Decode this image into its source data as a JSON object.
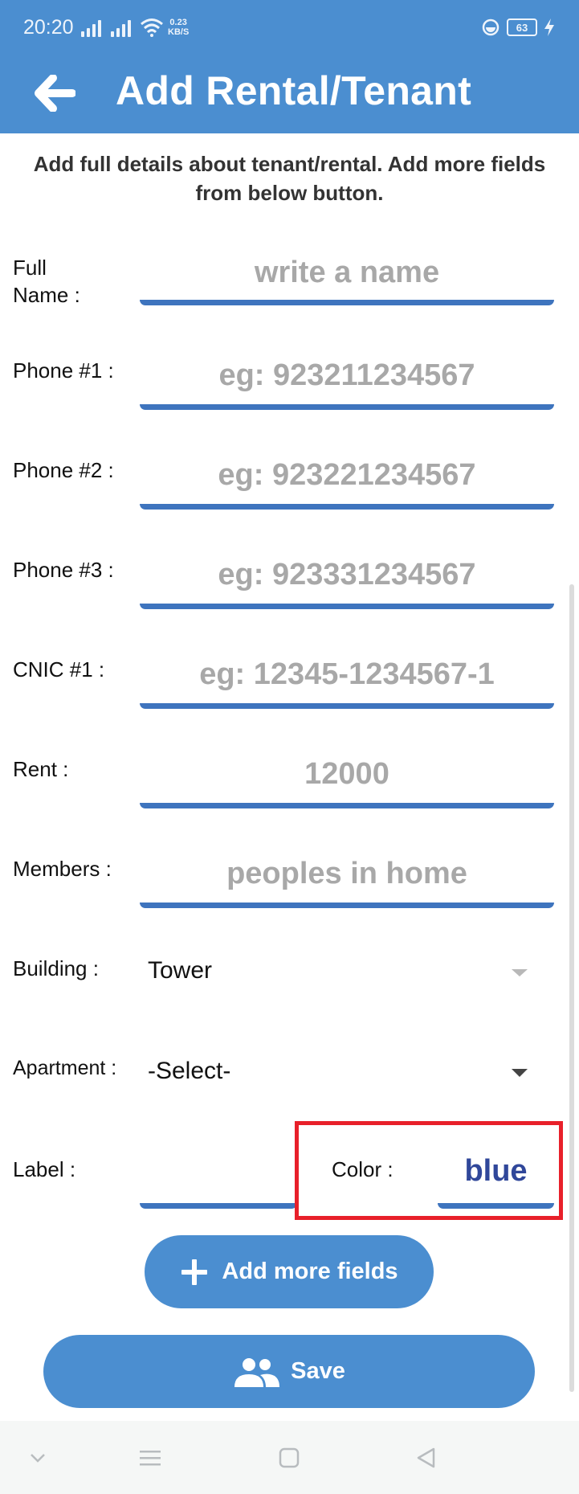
{
  "status_bar": {
    "time": "20:20",
    "speed": "0.23",
    "speed_unit": "KB/S",
    "battery": "63"
  },
  "header": {
    "title": "Add Rental/Tenant"
  },
  "intro": {
    "line1": "Add full details about tenant/rental. Add more fields",
    "line2": "from below button."
  },
  "form": {
    "full_name": {
      "label_line1": "Full",
      "label_line2": "Name :",
      "placeholder": "write a name"
    },
    "phone1": {
      "label": "Phone #1 :",
      "placeholder": "eg: 923211234567"
    },
    "phone2": {
      "label": "Phone #2 :",
      "placeholder": "eg: 923221234567"
    },
    "phone3": {
      "label": "Phone #3 :",
      "placeholder": "eg: 923331234567"
    },
    "cnic1": {
      "label": "CNIC #1 :",
      "placeholder": "eg: 12345-1234567-1"
    },
    "rent": {
      "label": "Rent :",
      "placeholder": "12000"
    },
    "members": {
      "label": "Members :",
      "placeholder": "peoples in home"
    },
    "building": {
      "label": "Building :",
      "value": "Tower"
    },
    "apartment": {
      "label": "Apartment :",
      "value": "-Select-"
    },
    "label_field": {
      "label": "Label :",
      "value": ""
    },
    "color_field": {
      "label": "Color :",
      "value": "blue"
    }
  },
  "buttons": {
    "add_more": "Add more fields",
    "save": "Save"
  },
  "colors": {
    "primary": "#4b8ed0",
    "underline": "#3e74be",
    "highlight": "#e8202a",
    "color_value": "#30479a"
  },
  "icons": {
    "back": "arrow-left-icon",
    "add": "plus-icon",
    "save": "people-icon"
  }
}
